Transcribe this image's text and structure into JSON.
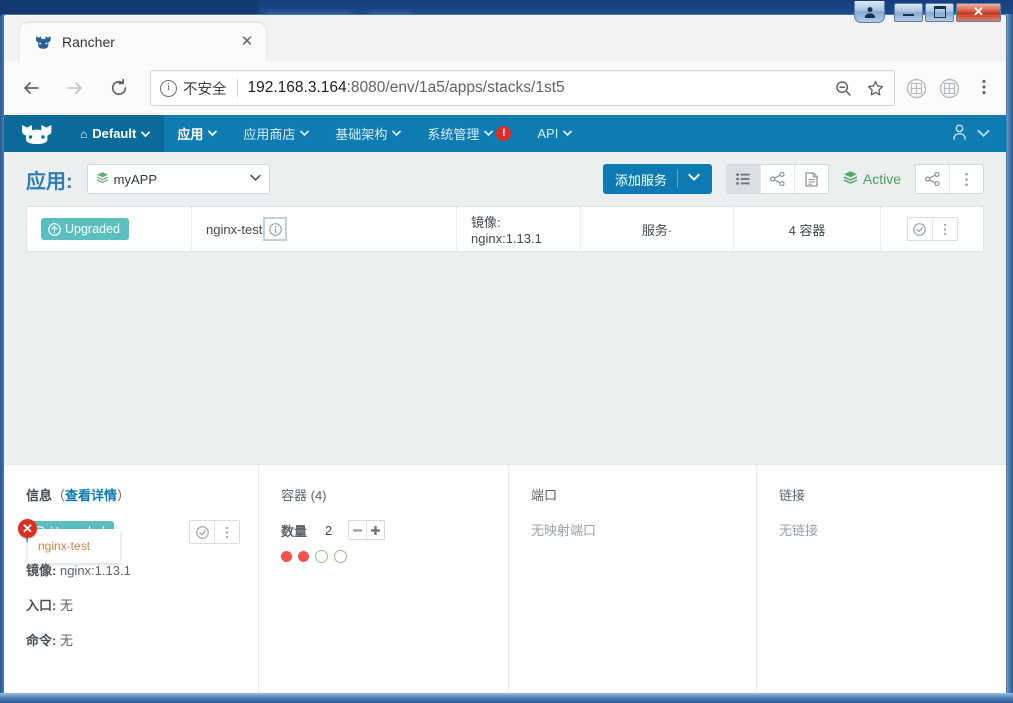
{
  "window": {
    "titlebar_buttons": [
      {
        "name": "user-account-button",
        "glyph": "person"
      },
      {
        "name": "minimize-button",
        "glyph": "minimize"
      },
      {
        "name": "maximize-button",
        "glyph": "maximize"
      },
      {
        "name": "close-button",
        "glyph": "✕"
      }
    ]
  },
  "browser": {
    "tab": {
      "title": "Rancher",
      "favicon": "rancher-cow-icon",
      "close_label": "✕"
    },
    "nav": {
      "back_icon": "arrow-left-icon",
      "forward_icon": "arrow-right-icon",
      "reload_icon": "reload-icon"
    },
    "omnibox": {
      "security_label": "不安全",
      "security_icon": "info-circle-icon",
      "url_host": "192.168.3.164",
      "url_rest": ":8080/env/1a5/apps/stacks/1st5",
      "full_url": "192.168.3.164:8080/env/1a5/apps/stacks/1st5",
      "zoom_icon": "search-minus-icon",
      "bookmark_icon": "star-icon"
    },
    "extensions": [
      "extension-icon-1",
      "extension-icon-2"
    ],
    "menu_icon": "three-dots-vertical-icon"
  },
  "rancher_nav": {
    "brand_icon": "rancher-cow-logo",
    "environment": {
      "label": "Default",
      "home_icon": "home-icon",
      "caret": "⌄"
    },
    "items": [
      {
        "label": "应用",
        "active": true,
        "caret": "⌄",
        "alert": null
      },
      {
        "label": "应用商店",
        "active": false,
        "caret": "⌄",
        "alert": null
      },
      {
        "label": "基础架构",
        "active": false,
        "caret": "⌄",
        "alert": null
      },
      {
        "label": "系统管理",
        "active": false,
        "caret": "⌄",
        "alert": "!"
      },
      {
        "label": "API",
        "active": false,
        "caret": "⌄",
        "alert": null
      }
    ],
    "user_icon": "user-avatar-icon",
    "user_caret": "⌄"
  },
  "page_header": {
    "title": "应用:",
    "stack_select": {
      "value": "myAPP",
      "icon": "stack-layers-icon",
      "caret": "⌄"
    },
    "add_service_button": {
      "label": "添加服务",
      "caret": "⌄"
    },
    "view_buttons": [
      {
        "name": "list-view-button",
        "icon": "list-icon",
        "active": true
      },
      {
        "name": "graph-view-button",
        "icon": "share-graph-icon",
        "active": false
      },
      {
        "name": "compose-view-button",
        "icon": "document-icon",
        "active": false
      }
    ],
    "stack_state": {
      "label": "Active",
      "icon": "stack-layers-icon",
      "color": "#4aa05a"
    },
    "stack_actions": [
      {
        "name": "stack-share-button",
        "icon": "share-graph-icon"
      },
      {
        "name": "stack-menu-button",
        "icon": "three-dots-vertical-icon"
      }
    ]
  },
  "service_table": {
    "rows": [
      {
        "state_badge": {
          "label": "Upgraded",
          "icon": "arrow-up-circle-icon",
          "color": "#5bbfc0"
        },
        "name": "nginx-test",
        "info_icon": "info-circle-icon",
        "image": "镜像: nginx:1.13.1",
        "service_type": "服务·",
        "containers": "4 容器",
        "actions": [
          {
            "name": "row-check-button",
            "icon": "check-circle-icon"
          },
          {
            "name": "row-menu-button",
            "icon": "three-dots-vertical-icon"
          }
        ]
      }
    ]
  },
  "error_marker": {
    "icon": "close-circle-icon",
    "glyph": "✕",
    "color": "#d93025",
    "tooltip_label": "nginx-test"
  },
  "detail": {
    "info": {
      "head_main": "信息",
      "head_paren_open": "（",
      "head_link": "查看详情",
      "head_paren_close": "）",
      "state_badge": {
        "label": "Upgraded",
        "icon": "arrow-up-circle-icon"
      },
      "actions": [
        {
          "name": "detail-check-button",
          "icon": "check-circle-icon"
        },
        {
          "name": "detail-menu-button",
          "icon": "three-dots-vertical-icon"
        }
      ],
      "image_key": "镜像:",
      "image_value": "nginx:1.13.1",
      "entrypoint_key": "入口:",
      "entrypoint_value": "无",
      "command_key": "命令:",
      "command_value": "无"
    },
    "containers": {
      "head": "容器 (4)",
      "scale_label": "数量",
      "scale_value": "2",
      "minus_label": "−",
      "plus_label": "+",
      "dots": [
        "bad",
        "bad",
        "idle",
        "idle"
      ]
    },
    "ports": {
      "head": "端口",
      "value": "无映射端口"
    },
    "links": {
      "head": "链接",
      "value": "无链接"
    }
  },
  "colors": {
    "rancher_blue": "#0e7cb0",
    "rancher_blue_dark": "#0a6b9b",
    "accent_button": "#0c7bb3",
    "badge_teal": "#5bbfc0",
    "state_green": "#4aa05a",
    "error_red": "#d93025",
    "container_bad": "#f4514b",
    "tooltip_text": "#c1874b",
    "page_bg": "#eceff0"
  }
}
